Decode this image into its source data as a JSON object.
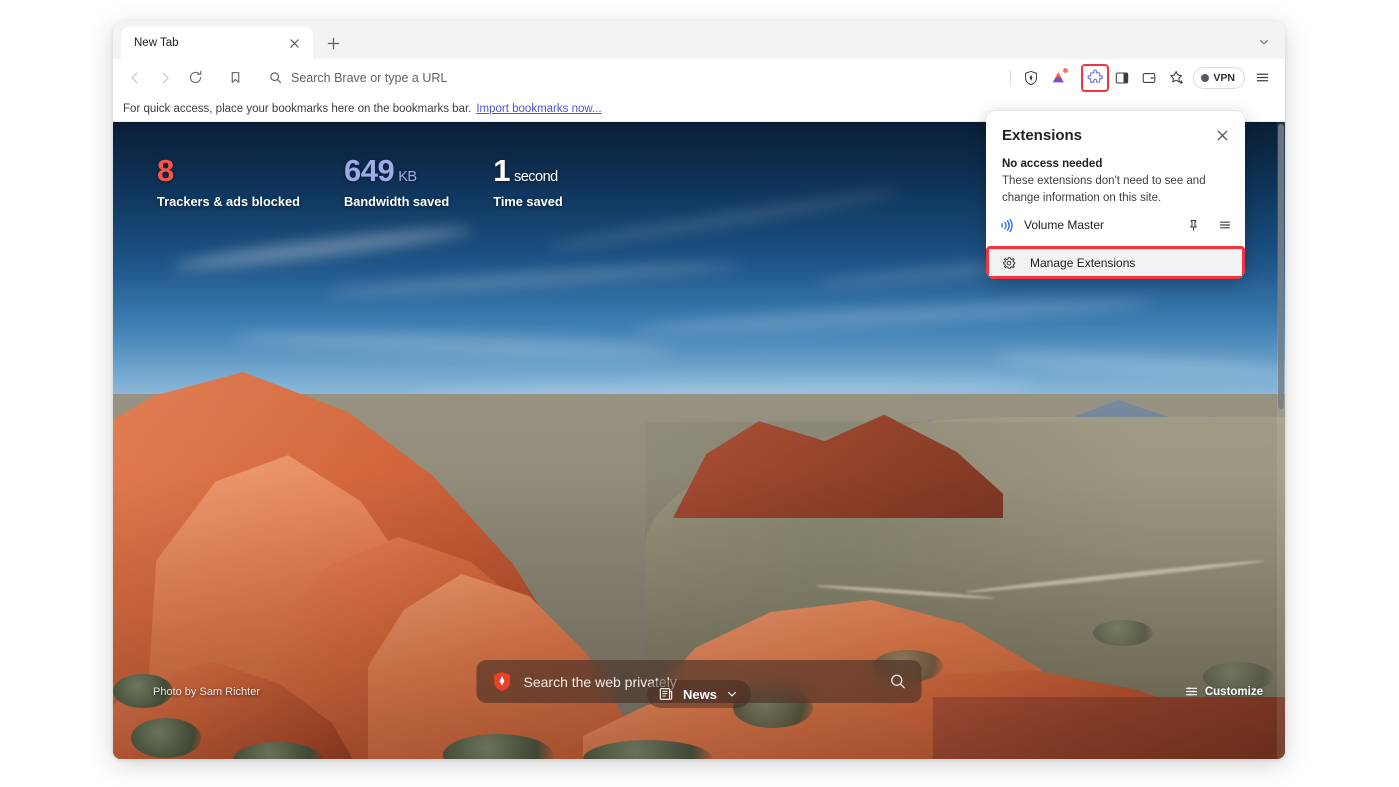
{
  "browser": {
    "tab": {
      "title": "New Tab",
      "close_icon": "close-icon"
    },
    "new_tab_icon": "plus-icon",
    "tab_list_icon": "chevron-down-icon",
    "toolbar": {
      "back_icon": "chevron-left-icon",
      "forward_icon": "chevron-right-icon",
      "reload_icon": "reload-icon",
      "bookmark_icon": "bookmark-icon",
      "search_icon": "search-icon",
      "omnibox_placeholder": "Search Brave or type a URL",
      "shields_icon": "brave-shields-icon",
      "rewards_icon": "brave-rewards-icon",
      "extensions_icon": "puzzle-piece-icon",
      "sidebar_icon": "sidebar-panel-icon",
      "wallet_icon": "brave-wallet-icon",
      "leo_icon": "leo-ai-icon",
      "vpn_label": "VPN",
      "menu_icon": "hamburger-menu-icon"
    },
    "bookmarks_bar": {
      "message": "For quick access, place your bookmarks here on the bookmarks bar.",
      "import_link": "Import bookmarks now..."
    }
  },
  "new_tab_page": {
    "stats": [
      {
        "value": "8",
        "unit": "",
        "label": "Trackers & ads blocked",
        "color": "#fb5447"
      },
      {
        "value": "649",
        "unit": "KB",
        "label": "Bandwidth saved",
        "color": "#a0aae8"
      },
      {
        "value": "1",
        "unit": "second",
        "label": "Time saved",
        "color": "#ffffff"
      }
    ],
    "search": {
      "placeholder": "Search the web privately",
      "logo_icon": "brave-lion-icon",
      "search_icon": "search-icon"
    },
    "photo_credit": "Photo by Sam Richter",
    "news": {
      "label": "News",
      "icon": "news-icon",
      "chevron_icon": "chevron-down-icon"
    },
    "customize": {
      "label": "Customize",
      "icon": "sliders-icon"
    }
  },
  "extensions_popup": {
    "title": "Extensions",
    "close_icon": "close-icon",
    "section_heading": "No access needed",
    "section_description": "These extensions don't need to see and change information on this site.",
    "extensions": [
      {
        "name": "Volume Master",
        "icon": "volume-wave-icon",
        "pin_icon": "pin-icon",
        "menu_icon": "kebab-menu-icon"
      }
    ],
    "manage": {
      "label": "Manage Extensions",
      "icon": "gear-icon"
    },
    "highlight_color": "#f5333f"
  }
}
